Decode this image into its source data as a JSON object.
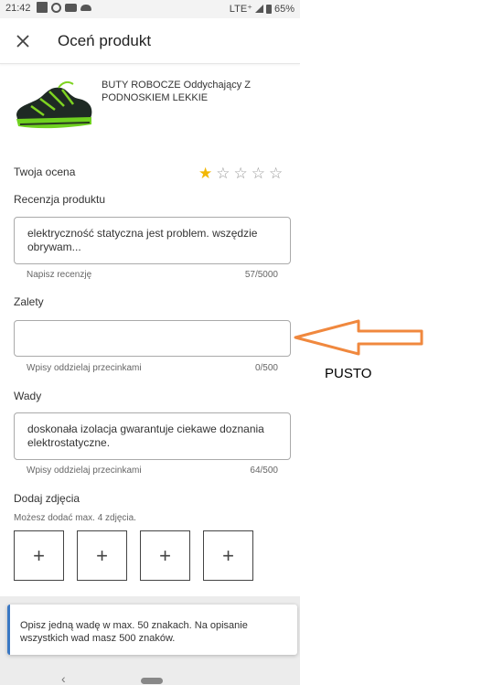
{
  "status_bar": {
    "time": "21:42",
    "network": "LTE⁺",
    "battery": "65%"
  },
  "header": {
    "title": "Oceń produkt"
  },
  "product": {
    "name": "BUTY ROBOCZE Oddychający Z PODNOSKIEM LEKKIE"
  },
  "rating": {
    "label": "Twoja ocena",
    "value": 1,
    "max": 5,
    "star_color": "#f2b705"
  },
  "review": {
    "label": "Recenzja produktu",
    "value": "elektryczność statyczna jest problem. wszędzie obrywam...",
    "hint": "Napisz recenzję",
    "counter": "57/5000"
  },
  "pros": {
    "label": "Zalety",
    "value": "",
    "hint": "Wpisy oddzielaj przecinkami",
    "counter": "0/500"
  },
  "cons": {
    "label": "Wady",
    "value": "doskonała izolacja gwarantuje ciekawe doznania elektrostatyczne.",
    "hint": "Wpisy oddzielaj przecinkami",
    "counter": "64/500"
  },
  "photos": {
    "label": "Dodaj zdjęcia",
    "subtitle": "Możesz dodać max. 4 zdjęcia.",
    "add_glyph": "+"
  },
  "tooltip": {
    "text": "Opisz jedną wadę w max. 50 znakach. Na opisanie wszystkich wad masz 500 znaków.",
    "accent": "#3a78c4"
  },
  "annotation": {
    "text": "PUSTO",
    "arrow_color": "#f0883e"
  },
  "icons": {
    "close": "close-icon",
    "back": "back-icon",
    "home": "home-icon"
  }
}
